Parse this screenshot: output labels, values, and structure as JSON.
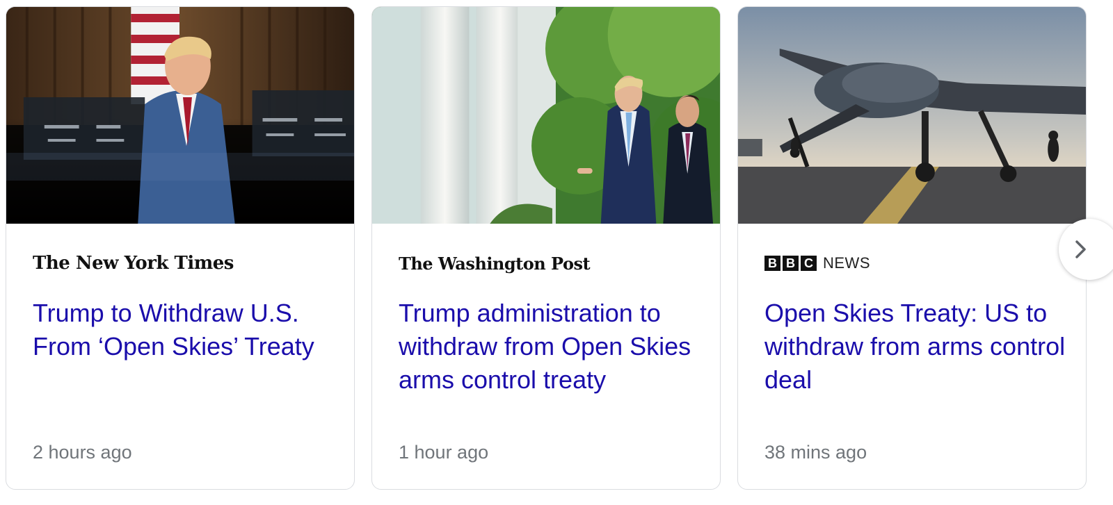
{
  "cards": [
    {
      "source": "The New York Times",
      "headline": "Trump to Withdraw U.S. From ‘Open Skies’ Treaty",
      "time": "2 hours ago"
    },
    {
      "source": "The Washington Post",
      "headline": "Trump administration to withdraw from Open Skies arms control treaty",
      "time": "1 hour ago"
    },
    {
      "source_logo_letters": [
        "B",
        "B",
        "C"
      ],
      "source_logo_word": "NEWS",
      "headline": "Open Skies Treaty: US to withdraw from arms control deal",
      "time": "38 mins ago"
    }
  ],
  "colors": {
    "headline": "#1a0dab",
    "timestamp": "#70757a",
    "border": "#dadce0"
  },
  "icons": {
    "next": "chevron-right-icon"
  }
}
